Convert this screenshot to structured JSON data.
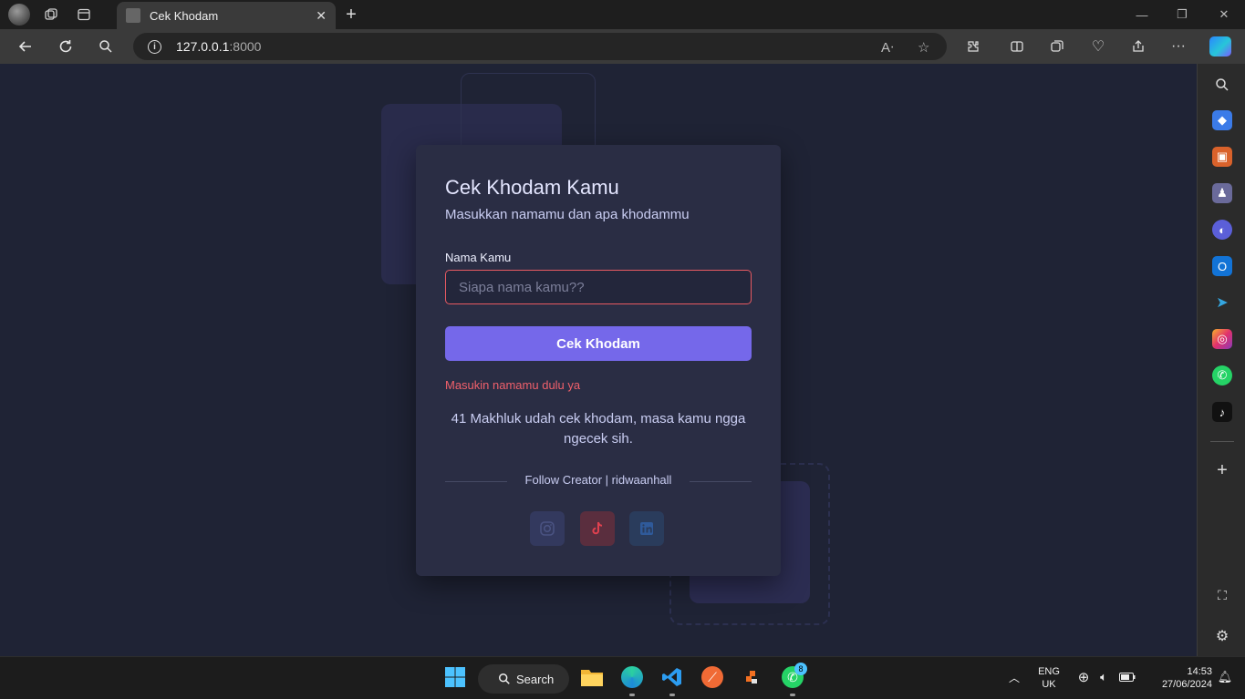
{
  "browser": {
    "tab_title": "Cek Khodam",
    "url_host": "127.0.0.1",
    "url_port": ":8000"
  },
  "page": {
    "title": "Cek Khodam Kamu",
    "subtitle": "Masukkan namamu dan apa khodammu",
    "name_label": "Nama Kamu",
    "name_value": "",
    "name_placeholder": "Siapa nama kamu??",
    "submit_label": "Cek Khodam",
    "error_message": "Masukin namamu dulu ya",
    "counter_text": "41 Makhluk udah cek khodam, masa kamu ngga ngecek sih.",
    "follow_text": "Follow Creator | ridwaanhall",
    "social": [
      "instagram-icon",
      "tiktok-icon",
      "linkedin-icon"
    ],
    "accent_color": "#7568ea",
    "error_color": "#f0606b"
  },
  "taskbar": {
    "search_label": "Search",
    "whatsapp_badge": "8",
    "lang_1": "ENG",
    "lang_2": "UK",
    "time": "14:53",
    "date": "27/06/2024"
  }
}
